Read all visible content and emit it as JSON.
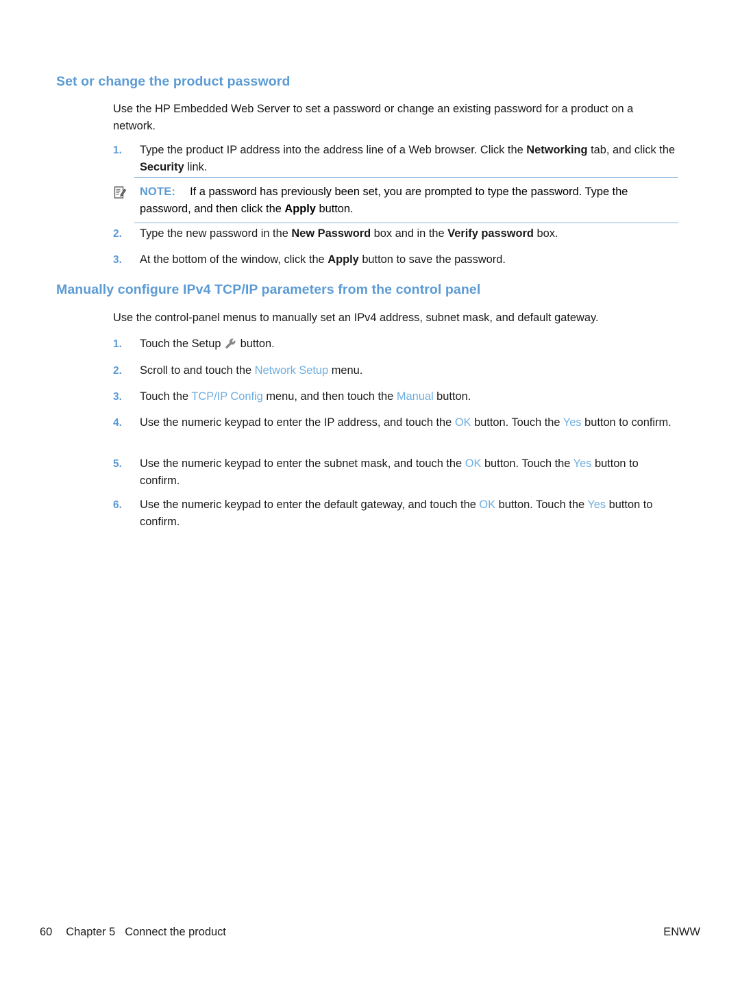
{
  "document": {
    "sections": [
      {
        "heading": "Set or change the product password",
        "intro": "Use the HP Embedded Web Server to set a password or change an existing password for a product on a network.",
        "steps": [
          {
            "number": "1.",
            "parts": [
              {
                "t": "Type the product IP address into the address line of a Web browser. Click the ",
                "style": "normal"
              },
              {
                "t": "Networking",
                "style": "bold"
              },
              {
                "t": " tab, and click the ",
                "style": "normal"
              },
              {
                "t": "Security",
                "style": "bold"
              },
              {
                "t": " link.",
                "style": "normal"
              }
            ]
          },
          {
            "number": "2.",
            "parts": [
              {
                "t": "Type the new password in the ",
                "style": "normal"
              },
              {
                "t": "New Password",
                "style": "bold"
              },
              {
                "t": " box and in the ",
                "style": "normal"
              },
              {
                "t": "Verify password",
                "style": "bold"
              },
              {
                "t": " box.",
                "style": "normal"
              }
            ]
          },
          {
            "number": "3.",
            "parts": [
              {
                "t": "At the bottom of the window, click the ",
                "style": "normal"
              },
              {
                "t": "Apply",
                "style": "bold"
              },
              {
                "t": " button to save the password.",
                "style": "normal"
              }
            ]
          }
        ],
        "note": {
          "icon": "note-pencil-icon",
          "label": "NOTE:",
          "parts": [
            {
              "t": "If a password has previously been set, you are prompted to type the password. Type the password, and then click the ",
              "style": "normal"
            },
            {
              "t": "Apply",
              "style": "bold"
            },
            {
              "t": " button.",
              "style": "normal"
            }
          ]
        }
      },
      {
        "heading": "Manually configure IPv4 TCP/IP parameters from the control panel",
        "intro": "Use the control-panel menus to manually set an IPv4 address, subnet mask, and default gateway.",
        "steps": [
          {
            "number": "1.",
            "parts": [
              {
                "t": "Touch the Setup ",
                "style": "normal"
              },
              {
                "t": "",
                "style": "icon",
                "icon": "wrench-icon"
              },
              {
                "t": " button.",
                "style": "normal"
              }
            ]
          },
          {
            "number": "2.",
            "parts": [
              {
                "t": "Scroll to and touch the ",
                "style": "normal"
              },
              {
                "t": "Network Setup",
                "style": "ui"
              },
              {
                "t": " menu.",
                "style": "normal"
              }
            ]
          },
          {
            "number": "3.",
            "parts": [
              {
                "t": "Touch the ",
                "style": "normal"
              },
              {
                "t": "TCP/IP Config",
                "style": "ui"
              },
              {
                "t": " menu, and then touch the ",
                "style": "normal"
              },
              {
                "t": "Manual",
                "style": "ui"
              },
              {
                "t": " button.",
                "style": "normal"
              }
            ]
          },
          {
            "number": "4.",
            "parts": [
              {
                "t": "Use the numeric keypad to enter the IP address, and touch the ",
                "style": "normal"
              },
              {
                "t": "OK",
                "style": "ui"
              },
              {
                "t": " button. Touch the ",
                "style": "normal"
              },
              {
                "t": "Yes",
                "style": "ui"
              },
              {
                "t": " button to confirm.",
                "style": "normal"
              }
            ]
          },
          {
            "number": "5.",
            "parts": [
              {
                "t": "Use the numeric keypad to enter the subnet mask, and touch the ",
                "style": "normal"
              },
              {
                "t": "OK",
                "style": "ui"
              },
              {
                "t": " button. Touch the ",
                "style": "normal"
              },
              {
                "t": "Yes",
                "style": "ui"
              },
              {
                "t": " button to confirm.",
                "style": "normal"
              }
            ]
          },
          {
            "number": "6.",
            "parts": [
              {
                "t": "Use the numeric keypad to enter the default gateway, and touch the ",
                "style": "normal"
              },
              {
                "t": "OK",
                "style": "ui"
              },
              {
                "t": " button. Touch the ",
                "style": "normal"
              },
              {
                "t": "Yes",
                "style": "ui"
              },
              {
                "t": " button to confirm.",
                "style": "normal"
              }
            ]
          }
        ]
      }
    ],
    "footer": {
      "page_number": "60",
      "chapter": "Chapter 5",
      "chapter_title": "Connect the product",
      "right_mark": "ENWW"
    },
    "colors": {
      "heading_blue": "#5b9bd5",
      "ui_blue": "#6caee0",
      "rule_blue": "#7fb2dd",
      "text_black": "#1a1a1a"
    }
  }
}
